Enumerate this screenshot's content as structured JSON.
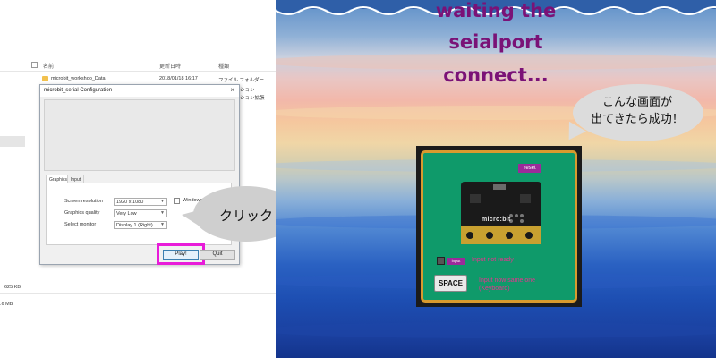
{
  "explorer": {
    "columns": {
      "name": "名前",
      "date": "更新日時",
      "type": "種類"
    },
    "rows": [
      {
        "name": "microbit_workshop_Data",
        "date": "2018/01/18 16:17",
        "type": "ファイル フォルダー"
      },
      {
        "name": "",
        "date": "",
        "type": "ション"
      },
      {
        "name": "",
        "date": "",
        "type": "ション拡張"
      }
    ],
    "sizes": [
      "625 KB",
      ".6 MB"
    ]
  },
  "dialog": {
    "title": "microbit_serial Configuration",
    "close": "×",
    "tabs": [
      "Graphics",
      "Input"
    ],
    "settings": [
      {
        "label": "Screen resolution",
        "value": "1920 x 1080"
      },
      {
        "label": "Graphics quality",
        "value": "Very Low"
      },
      {
        "label": "Select monitor",
        "value": "Display 1 (Right)"
      }
    ],
    "windowed_label": "Windowed",
    "play_label": "Play!",
    "quit_label": "Quit"
  },
  "callouts": {
    "click": "クリック",
    "success_line1": "こんな画面が",
    "success_line2": "出てきたら成功！"
  },
  "game": {
    "title_line1": "waiting the",
    "title_line2": "seialport",
    "title_line3": "connect...",
    "reset_label": "reset",
    "board_label": "micro:bit",
    "input_label": "input",
    "input_desc": "Input not ready",
    "space_label": "SPACE",
    "space_desc_line1": "Input now same one",
    "space_desc_line2": "(Keyboard)"
  },
  "colors": {
    "title_purple": "#7a1277",
    "highlight_magenta": "#e81bd9",
    "panel_green": "#0f9a6a",
    "panel_border": "#d89a2e",
    "button_purple": "#9b2a9a",
    "desc_pink": "#e8338f"
  }
}
